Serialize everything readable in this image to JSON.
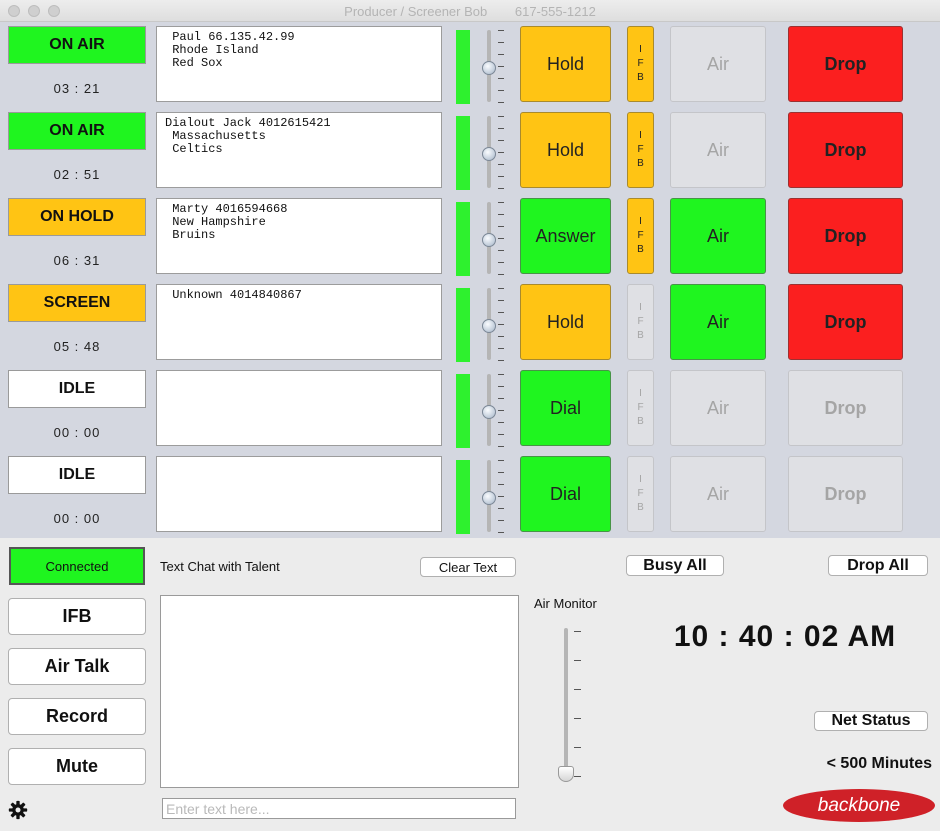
{
  "window": {
    "title": "Producer / Screener Bob",
    "phone": "617-555-1212"
  },
  "lines": [
    {
      "status": "ON AIR",
      "status_color": "#1ff51f",
      "timer": "03 : 21",
      "info": [
        " Paul 66.135.42.99",
        " Rhode Island",
        " Red Sox"
      ],
      "action": "Hold",
      "action_style": "yellow",
      "ifb_active": true,
      "air": "Air",
      "air_enabled": false,
      "drop": "Drop",
      "drop_enabled": true
    },
    {
      "status": "ON AIR",
      "status_color": "#1ff51f",
      "timer": "02 : 51",
      "info": [
        "Dialout Jack 4012615421",
        " Massachusetts",
        " Celtics"
      ],
      "action": "Hold",
      "action_style": "yellow",
      "ifb_active": true,
      "air": "Air",
      "air_enabled": false,
      "drop": "Drop",
      "drop_enabled": true
    },
    {
      "status": "ON HOLD",
      "status_color": "#ffc414",
      "timer": "06 : 31",
      "info": [
        " Marty 4016594668",
        " New Hampshire",
        " Bruins"
      ],
      "action": "Answer",
      "action_style": "green",
      "ifb_active": true,
      "air": "Air",
      "air_enabled": true,
      "drop": "Drop",
      "drop_enabled": true
    },
    {
      "status": "SCREEN",
      "status_color": "#ffc414",
      "timer": "05 : 48",
      "info": [
        " Unknown 4014840867"
      ],
      "action": "Hold",
      "action_style": "yellow",
      "ifb_active": false,
      "air": "Air",
      "air_enabled": true,
      "drop": "Drop",
      "drop_enabled": true
    },
    {
      "status": "IDLE",
      "status_color": "#ffffff",
      "timer": "00 : 00",
      "info": [],
      "action": "Dial",
      "action_style": "green",
      "ifb_active": false,
      "air": "Air",
      "air_enabled": false,
      "drop": "Drop",
      "drop_enabled": false
    },
    {
      "status": "IDLE",
      "status_color": "#ffffff",
      "timer": "00 : 00",
      "info": [],
      "action": "Dial",
      "action_style": "green",
      "ifb_active": false,
      "air": "Air",
      "air_enabled": false,
      "drop": "Drop",
      "drop_enabled": false
    }
  ],
  "ifb_letters": [
    "I",
    "F",
    "B"
  ],
  "bottom": {
    "connection": "Connected",
    "side_buttons": [
      "IFB",
      "Air Talk",
      "Record",
      "Mute"
    ],
    "chat_label": "Text Chat with Talent",
    "clear_text": "Clear Text",
    "chat_placeholder": "Enter text here...",
    "busy_all": "Busy All",
    "drop_all": "Drop All",
    "air_monitor_label": "Air Monitor",
    "clock": "10 : 40 : 02 AM",
    "net_status": "Net Status",
    "minutes": "< 500 Minutes",
    "logo": "backbone",
    "settings_icon": "gear-icon"
  }
}
